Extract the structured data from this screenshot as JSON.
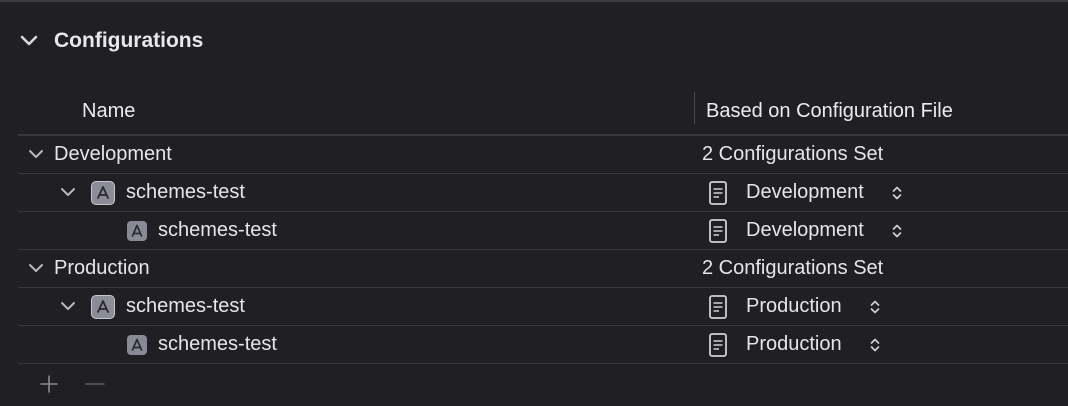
{
  "section": {
    "title": "Configurations",
    "collapse_icon": "chevron-down-icon"
  },
  "table": {
    "headers": {
      "name": "Name",
      "config_file": "Based on Configuration File"
    },
    "groups": [
      {
        "name": "Development",
        "summary": "2 Configurations Set",
        "project": {
          "name": "schemes-test",
          "icon": "project-icon",
          "config_file": "Development"
        },
        "target": {
          "name": "schemes-test",
          "icon": "app-target-icon",
          "config_file": "Development"
        }
      },
      {
        "name": "Production",
        "summary": "2 Configurations Set",
        "project": {
          "name": "schemes-test",
          "icon": "project-icon",
          "config_file": "Production"
        },
        "target": {
          "name": "schemes-test",
          "icon": "app-target-icon",
          "config_file": "Production"
        }
      }
    ]
  },
  "footer": {
    "add_icon": "plus-icon",
    "remove_icon": "minus-icon"
  },
  "colors": {
    "background": "#1f1f24",
    "text": "#e6e6e6",
    "separator": "#38383e",
    "icon": "#8c8c96"
  }
}
